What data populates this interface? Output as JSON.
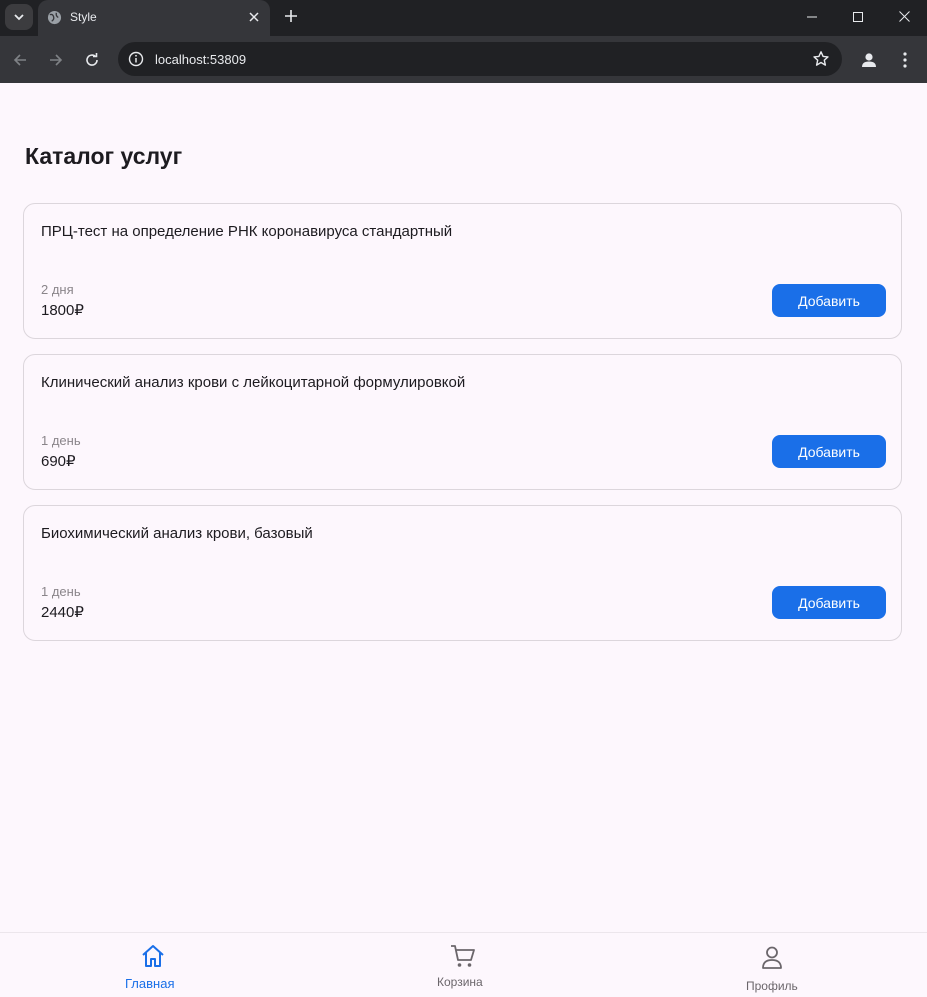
{
  "browser": {
    "tab_title": "Style",
    "url": "localhost:53809"
  },
  "page": {
    "title": "Каталог услуг"
  },
  "services": [
    {
      "name": "ПРЦ-тест на определение РНК коронавируса стандартный",
      "duration": "2 дня",
      "price": "1800₽",
      "button": "Добавить"
    },
    {
      "name": "Клинический анализ крови с лейкоцитарной формулировкой",
      "duration": "1 день",
      "price": "690₽",
      "button": "Добавить"
    },
    {
      "name": "Биохимический анализ крови, базовый",
      "duration": "1 день",
      "price": "2440₽",
      "button": "Добавить"
    }
  ],
  "bottom_nav": {
    "items": [
      {
        "label": "Главная",
        "icon": "home-icon",
        "active": true
      },
      {
        "label": "Корзина",
        "icon": "cart-icon",
        "active": false
      },
      {
        "label": "Профиль",
        "icon": "person-icon",
        "active": false
      }
    ]
  },
  "colors": {
    "accent": "#1a6fe8",
    "nav_active": "#1a6fe8",
    "nav_inactive": "#6b666b"
  }
}
